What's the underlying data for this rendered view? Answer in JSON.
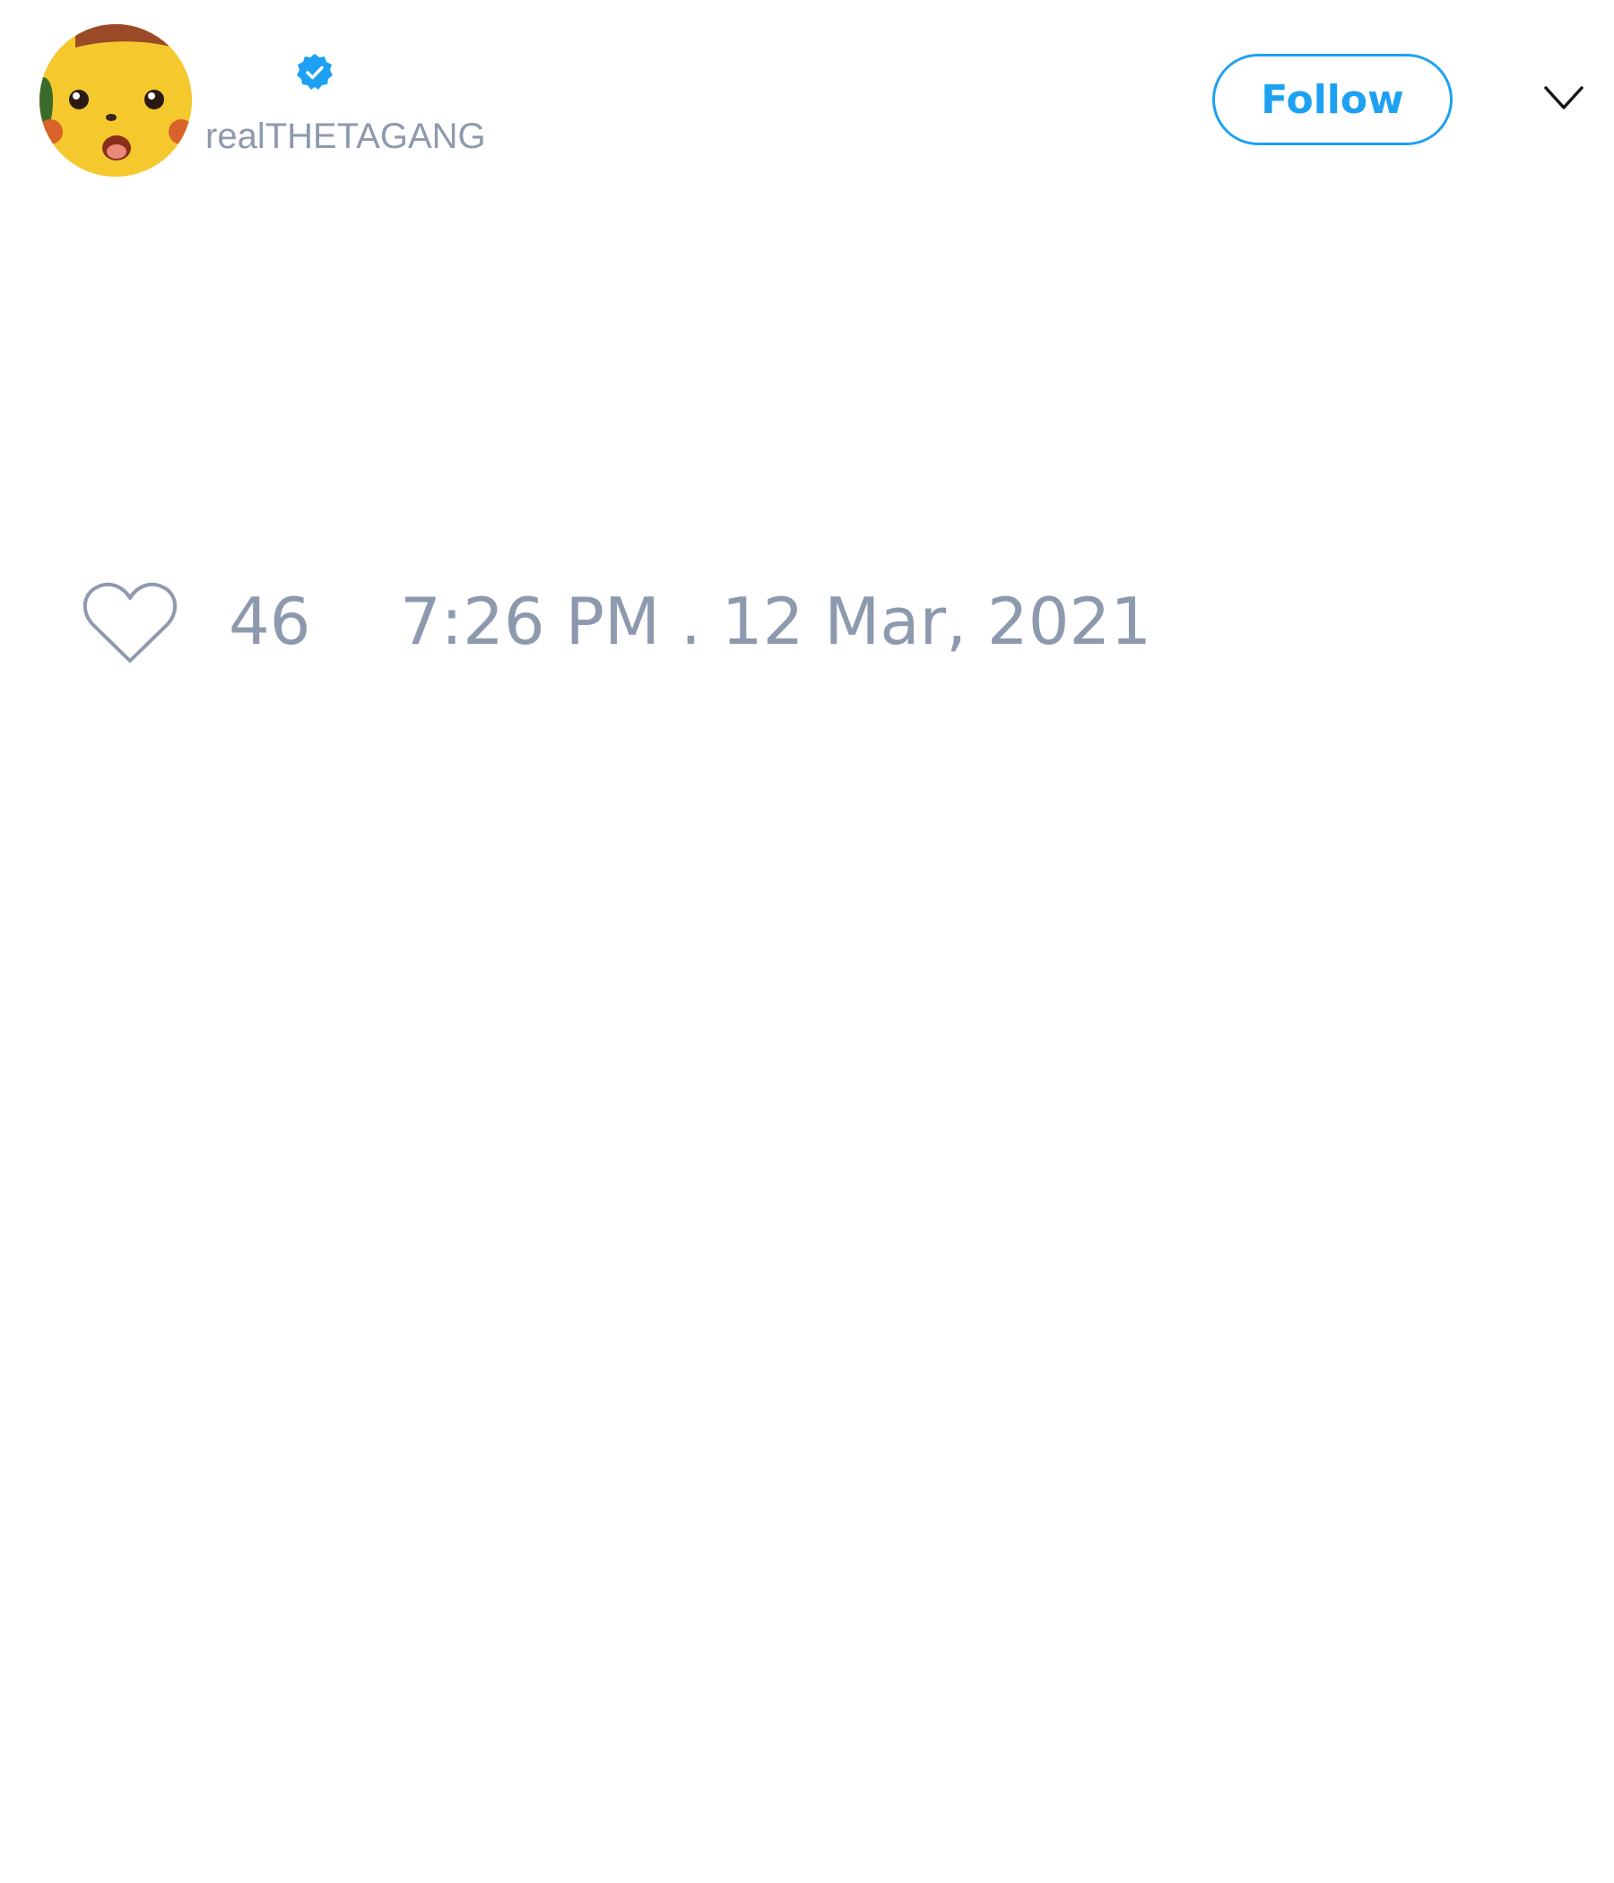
{
  "tweet": {
    "author": {
      "display_name": "",
      "handle": "realTHETAGANG",
      "avatar_icon": "pikachu-surprised-avatar",
      "verified": true,
      "verified_icon": "verified-badge-icon"
    },
    "follow_label": "Follow",
    "menu_icon": "chevron-down-icon",
    "like_icon": "heart-icon",
    "like_count": "46",
    "timestamp": "7:26 PM . 12 Mar, 2021"
  },
  "colors": {
    "accent": "#1da1f2",
    "muted_text": "#8d9aae",
    "background": "#ffffff"
  }
}
